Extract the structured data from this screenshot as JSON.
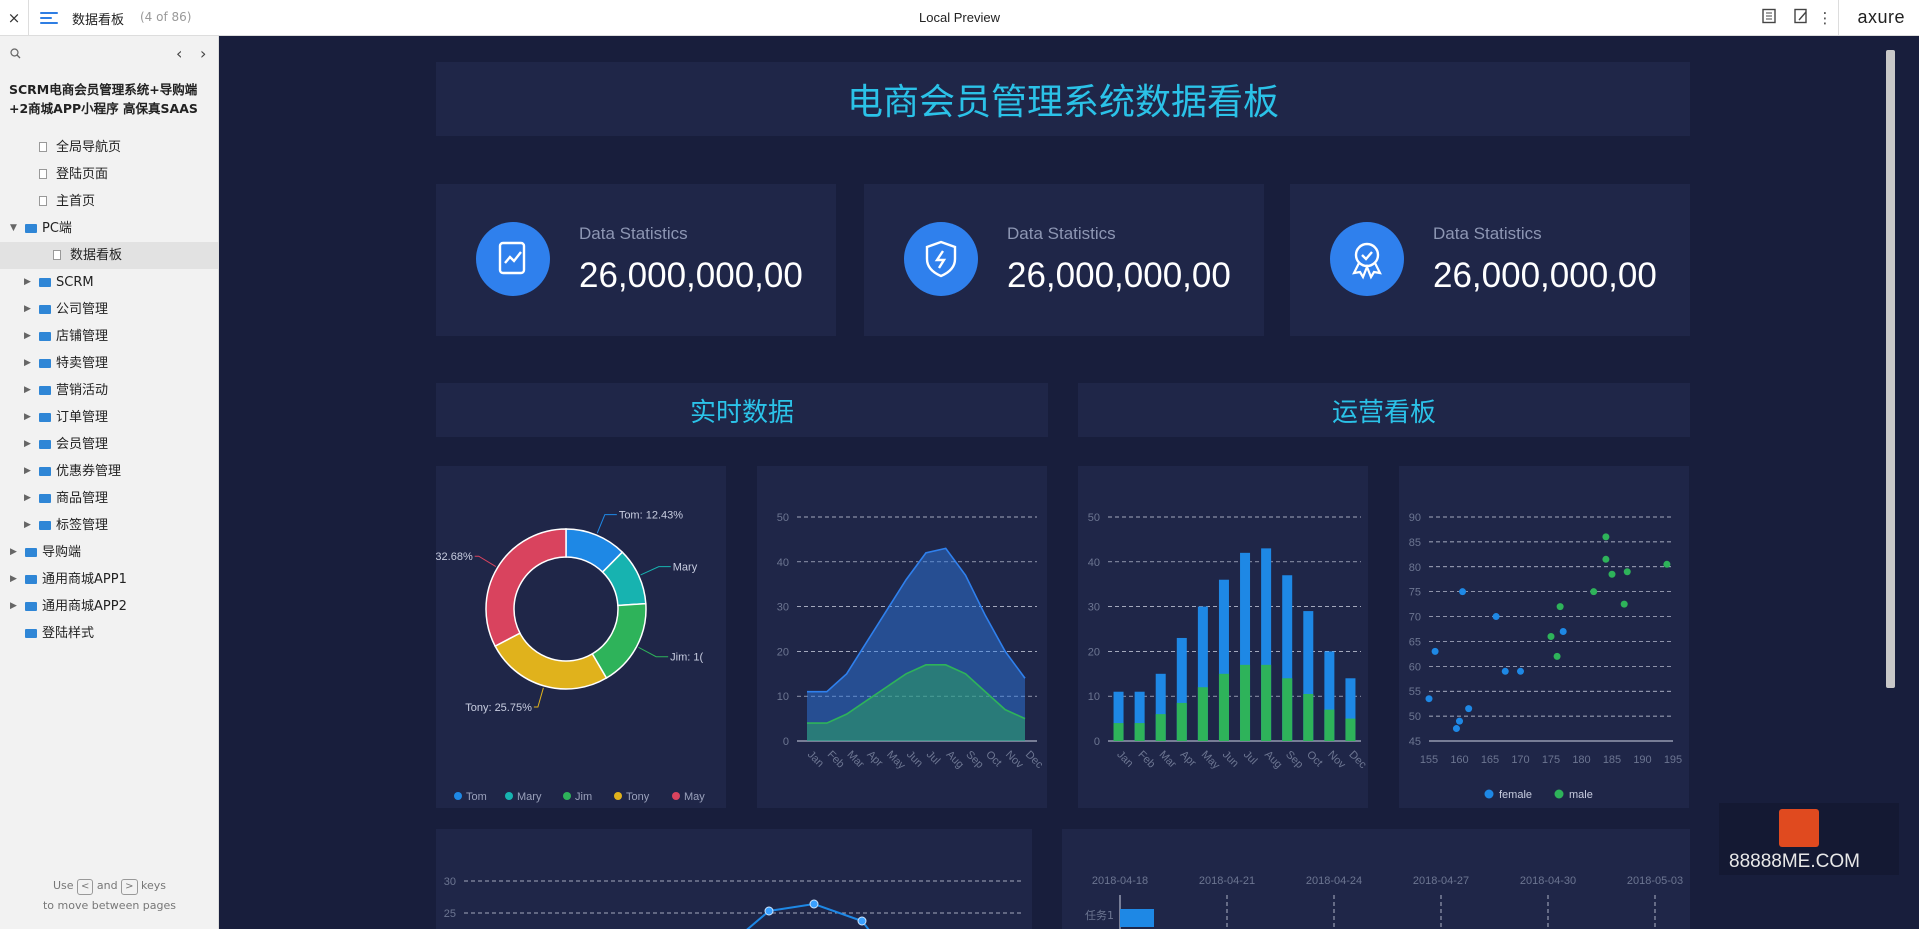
{
  "topbar": {
    "close": "×",
    "page_title": "数据看板",
    "page_count": "(4 of 86)",
    "center_title": "Local Preview",
    "logo": "axure"
  },
  "sidebar": {
    "project": "SCRM电商会员管理系统+导购端+2商城APP小程序 高保真SAAS",
    "items": [
      {
        "label": "全局导航页",
        "type": "page",
        "level": 1
      },
      {
        "label": "登陆页面",
        "type": "page",
        "level": 1
      },
      {
        "label": "主首页",
        "type": "page",
        "level": 1
      },
      {
        "label": "PC端",
        "type": "folder",
        "level": 0,
        "open": true
      },
      {
        "label": "数据看板",
        "type": "page",
        "level": 2,
        "selected": true
      },
      {
        "label": "SCRM",
        "type": "folder",
        "level": 1
      },
      {
        "label": "公司管理",
        "type": "folder",
        "level": 1
      },
      {
        "label": "店铺管理",
        "type": "folder",
        "level": 1
      },
      {
        "label": "特卖管理",
        "type": "folder",
        "level": 1
      },
      {
        "label": "营销活动",
        "type": "folder",
        "level": 1
      },
      {
        "label": "订单管理",
        "type": "folder",
        "level": 1
      },
      {
        "label": "会员管理",
        "type": "folder",
        "level": 1
      },
      {
        "label": "优惠券管理",
        "type": "folder",
        "level": 1
      },
      {
        "label": "商品管理",
        "type": "folder",
        "level": 1
      },
      {
        "label": "标签管理",
        "type": "folder",
        "level": 1
      },
      {
        "label": "导购端",
        "type": "folder",
        "level": 0
      },
      {
        "label": "通用商城APP1",
        "type": "folder",
        "level": 0
      },
      {
        "label": "通用商城APP2",
        "type": "folder",
        "level": 0
      },
      {
        "label": "登陆样式",
        "type": "folder",
        "level": 0,
        "noarrow": true
      }
    ],
    "hint_use": "Use",
    "hint_and": "and",
    "hint_keys": "keys",
    "hint_line2": "to move between pages",
    "key_prev": "<",
    "key_next": ">"
  },
  "dashboard": {
    "title": "电商会员管理系统数据看板",
    "stats": [
      {
        "label": "Data Statistics",
        "value": "26,000,000,00",
        "icon": "chart-doc-icon"
      },
      {
        "label": "Data Statistics",
        "value": "26,000,000,00",
        "icon": "shield-bolt-icon"
      },
      {
        "label": "Data Statistics",
        "value": "26,000,000,00",
        "icon": "award-badge-icon"
      }
    ],
    "section_left": "实时数据",
    "section_right": "运营看板"
  },
  "colors": {
    "blue": "#1e88e5",
    "teal": "#17b3b0",
    "green": "#2eb35a",
    "yellow": "#e0b21c",
    "red": "#d9435e",
    "cyan": "#2bc2e8"
  },
  "chart_data": [
    {
      "type": "pie",
      "slices": [
        {
          "name": "Tom",
          "value": 12.43,
          "color": "#1e88e5"
        },
        {
          "name": "Mary",
          "value": 11.5,
          "color": "#17b3b0"
        },
        {
          "name": "Jim",
          "value": 17.64,
          "color": "#2eb35a"
        },
        {
          "name": "Tony",
          "value": 25.75,
          "color": "#e0b21c"
        },
        {
          "name": "May",
          "value": 32.68,
          "color": "#d9435e"
        }
      ],
      "labels": [
        {
          "text": "Tom: 12.43%"
        },
        {
          "text": "Mary"
        },
        {
          "text": "Jim: 1("
        },
        {
          "text": "Tony: 25.75%"
        },
        {
          "text": "32.68%"
        }
      ],
      "legend": [
        "Tom",
        "Mary",
        "Jim",
        "Tony",
        "May"
      ]
    },
    {
      "type": "area",
      "categories": [
        "Jan",
        "Feb",
        "Mar",
        "Apr",
        "May",
        "Jun",
        "Jul",
        "Aug",
        "Sep",
        "Oct",
        "Nov",
        "Dec"
      ],
      "ylim": [
        0,
        50
      ],
      "yticks": [
        "0",
        "10",
        "20",
        "30",
        "40",
        "50"
      ],
      "series": [
        {
          "values": [
            11,
            11,
            15,
            22,
            29,
            36,
            42,
            43,
            37,
            28,
            20,
            14
          ],
          "color": "#2f80ed"
        },
        {
          "values": [
            4,
            4,
            6,
            9,
            12,
            15,
            17,
            17,
            15,
            11,
            7,
            5
          ],
          "color": "#2eb35a"
        }
      ]
    },
    {
      "type": "bar",
      "categories": [
        "Jan",
        "Feb",
        "Mar",
        "Apr",
        "May",
        "Jun",
        "Jul",
        "Aug",
        "Sep",
        "Oct",
        "Nov",
        "Dec"
      ],
      "ylim": [
        0,
        50
      ],
      "yticks": [
        "0",
        "10",
        "20",
        "30",
        "40",
        "50"
      ],
      "series": [
        {
          "values": [
            11,
            11,
            15,
            23,
            30,
            36,
            42,
            43,
            37,
            29,
            20,
            14
          ],
          "color": "#1e88e5"
        },
        {
          "values": [
            4,
            4,
            6,
            8.5,
            12,
            15,
            17,
            17,
            14,
            10.5,
            7,
            5
          ],
          "color": "#2eb35a"
        }
      ]
    },
    {
      "type": "scatter",
      "xlim": [
        155,
        195
      ],
      "ylim": [
        45,
        90
      ],
      "xticks": [
        "155",
        "160",
        "165",
        "170",
        "175",
        "180",
        "185",
        "190",
        "195"
      ],
      "yticks": [
        "45",
        "50",
        "55",
        "60",
        "65",
        "70",
        "75",
        "80",
        "85",
        "90"
      ],
      "series": [
        {
          "name": "female",
          "color": "#1e88e5",
          "points": [
            [
              155,
              53.5
            ],
            [
              156,
              63
            ],
            [
              159.5,
              47.5
            ],
            [
              160,
              49
            ],
            [
              160.5,
              75
            ],
            [
              161.5,
              51.5
            ],
            [
              166,
              70
            ],
            [
              167.5,
              59
            ],
            [
              170,
              59
            ],
            [
              177,
              67
            ]
          ]
        },
        {
          "name": "male",
          "color": "#2eb35a",
          "points": [
            [
              175,
              66
            ],
            [
              176,
              62
            ],
            [
              176.5,
              72
            ],
            [
              182,
              75
            ],
            [
              184,
              86
            ],
            [
              184,
              81.5
            ],
            [
              185,
              78.5
            ],
            [
              187,
              72.5
            ],
            [
              187.5,
              79
            ],
            [
              194,
              80.5
            ]
          ]
        }
      ]
    },
    {
      "type": "line",
      "yticks": [
        "25",
        "30"
      ]
    },
    {
      "type": "gantt",
      "dates": [
        "2018-04-18",
        "2018-04-21",
        "2018-04-24",
        "2018-04-27",
        "2018-04-30",
        "2018-05-03"
      ],
      "tasks": [
        "任务1"
      ]
    }
  ],
  "watermark": "88888ME.COM"
}
